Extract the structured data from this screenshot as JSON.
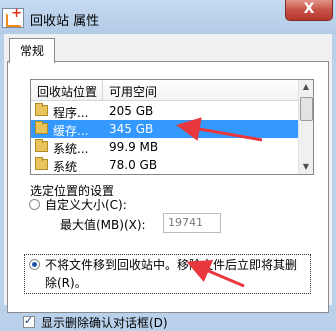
{
  "window": {
    "title": "回收站 属性",
    "close_label": "X"
  },
  "tabs": [
    {
      "label": "常规"
    }
  ],
  "list": {
    "columns": [
      "回收站位置",
      "可用空间"
    ],
    "rows": [
      {
        "name": "程序...",
        "size": "205 GB",
        "selected": false
      },
      {
        "name": "缓存...",
        "size": "345 GB",
        "selected": true
      },
      {
        "name": "系统...",
        "size": "99.9 MB",
        "selected": false
      },
      {
        "name": "系统",
        "size": "78.0 GB",
        "selected": false
      }
    ]
  },
  "settings": {
    "group_label": "选定位置的设置",
    "custom_size_label": "自定义大小(C):",
    "max_value_label": "最大值(MB)(X):",
    "max_value": "19741",
    "no_move_label_line1": "不将文件移到回收站中。移除文件后立即将其删",
    "no_move_label_line2": "除(R)。",
    "selected_option": "no_move",
    "show_confirm_label": "显示删除确认对话框(D)",
    "show_confirm_checked": true
  },
  "annotation_color": "#e8383d"
}
